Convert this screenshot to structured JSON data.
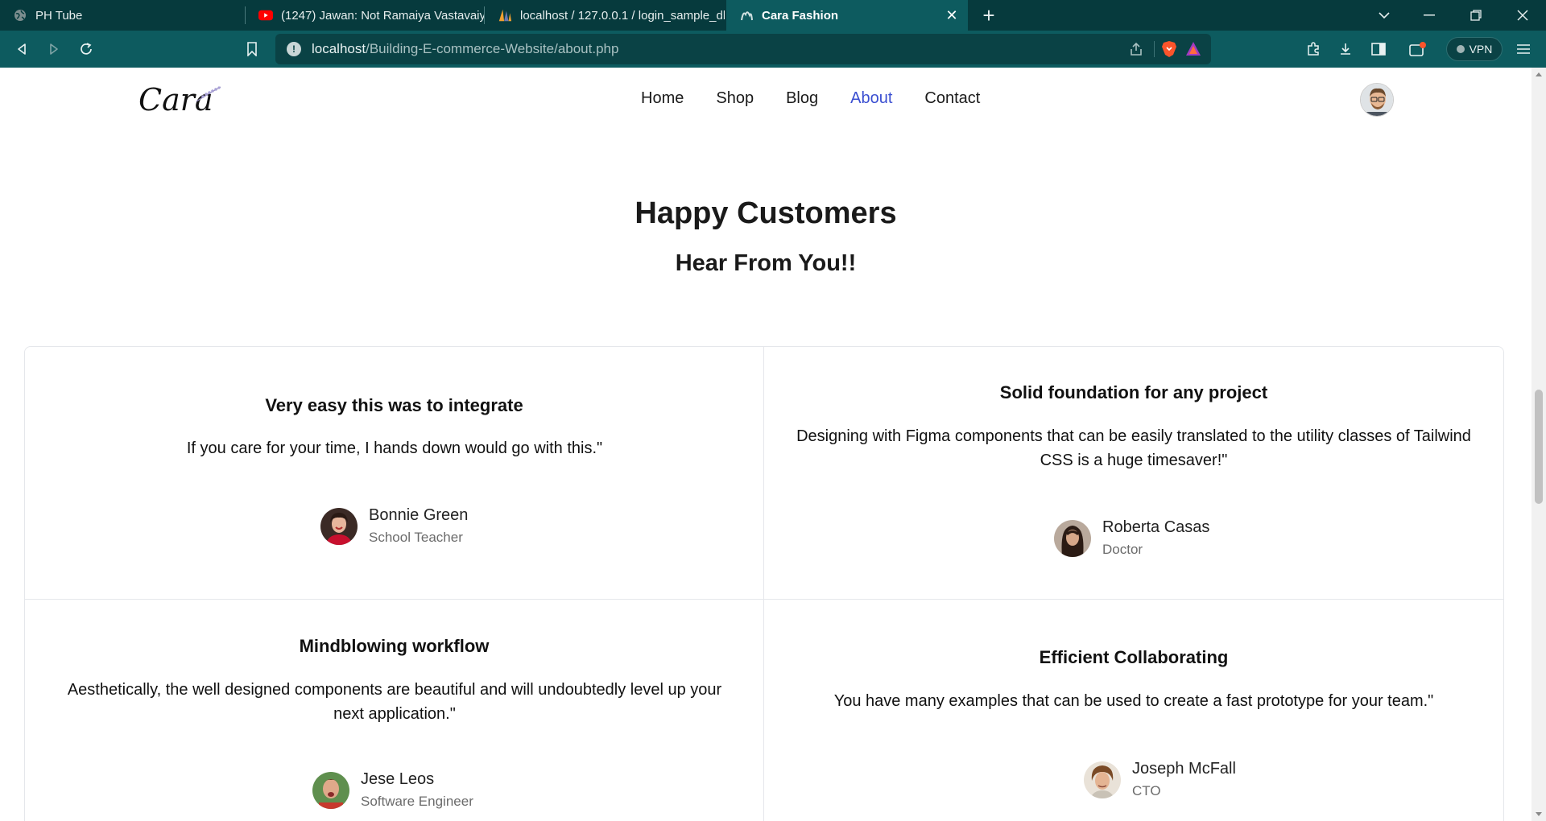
{
  "browser": {
    "tabs": [
      {
        "title": "PH Tube",
        "icon": "globe-icon",
        "active": false
      },
      {
        "title": "(1247) Jawan: Not Ramaiya Vastavaiya",
        "icon": "youtube-icon",
        "active": false
      },
      {
        "title": "localhost / 127.0.0.1 / login_sample_db",
        "icon": "phpmyadmin-icon",
        "active": false
      },
      {
        "title": "Cara Fashion",
        "icon": "cara-icon",
        "active": true
      }
    ],
    "new_tab_label": "+",
    "url_host": "localhost",
    "url_path": "/Building-E-commerce-Website/about.php",
    "vpn_label": "VPN",
    "accent_color": "#0d5b5f"
  },
  "site": {
    "logo_text": "Cara",
    "nav": [
      "Home",
      "Shop",
      "Blog",
      "About",
      "Contact"
    ],
    "active_nav": "About",
    "nav_active_color": "#3b4fd1"
  },
  "section": {
    "title": "Happy Customers",
    "subtitle": "Hear From You!!"
  },
  "testimonials": [
    {
      "title": "Very easy this was to integrate",
      "quote": "If you care for your time, I hands down would go with this.\"",
      "name": "Bonnie Green",
      "role": "School Teacher"
    },
    {
      "title": "Solid foundation for any project",
      "quote": "Designing with Figma components that can be easily translated to the utility classes of Tailwind CSS is a huge timesaver!\"",
      "name": "Roberta Casas",
      "role": "Doctor"
    },
    {
      "title": "Mindblowing workflow",
      "quote": "Aesthetically, the well designed components are beautiful and will undoubtedly level up your next application.\"",
      "name": "Jese Leos",
      "role": "Software Engineer"
    },
    {
      "title": "Efficient Collaborating",
      "quote": "You have many examples that can be used to create a fast prototype for your team.\"",
      "name": "Joseph McFall",
      "role": "CTO"
    }
  ]
}
